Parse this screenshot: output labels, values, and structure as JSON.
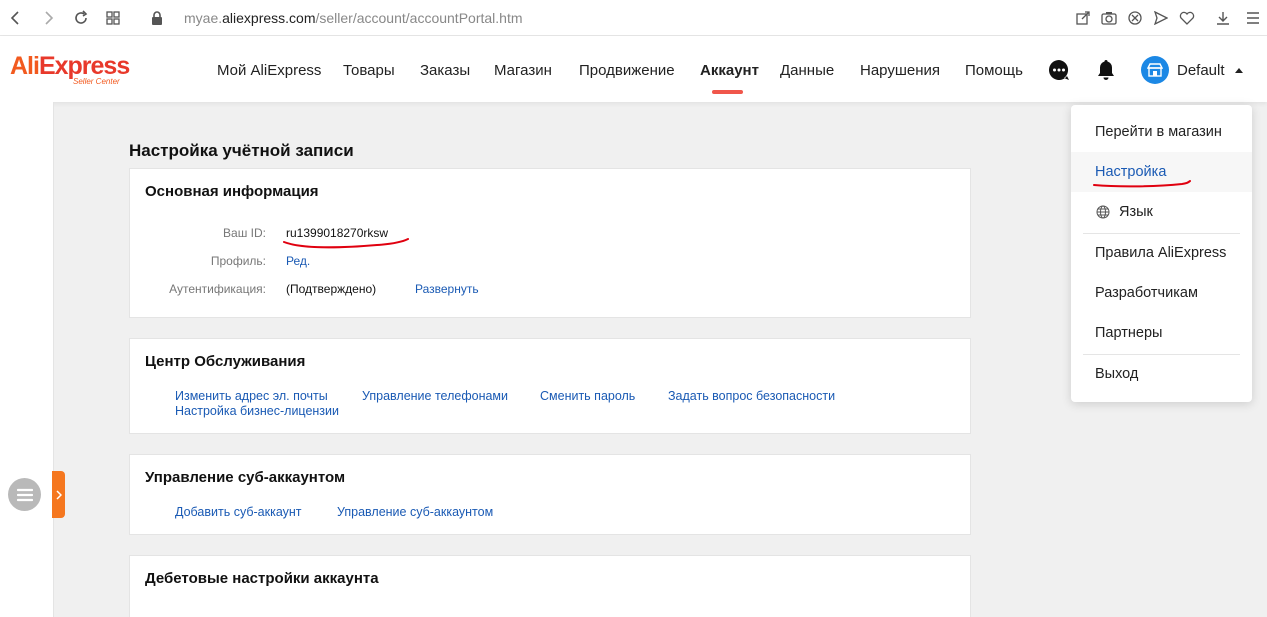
{
  "browser": {
    "url_prefix": "myae.",
    "url_host": "aliexpress.com",
    "url_path": "/seller/account/accountPortal.htm"
  },
  "header": {
    "logo_text_1": "Ali",
    "logo_text_2": "Express",
    "logo_sub": "Seller Center",
    "nav": [
      {
        "label": "Мой AliExpress"
      },
      {
        "label": "Товары"
      },
      {
        "label": "Заказы"
      },
      {
        "label": "Магазин"
      },
      {
        "label": "Продвижение"
      },
      {
        "label": "Аккаунт",
        "active": true
      },
      {
        "label": "Данные"
      },
      {
        "label": "Нарушения"
      },
      {
        "label": "Помощь"
      }
    ],
    "store_name": "Default"
  },
  "page": {
    "title": "Настройка учётной записи"
  },
  "basic_info": {
    "title": "Основная информация",
    "id_label": "Ваш ID:",
    "id_value": "ru1399018270rksw",
    "profile_label": "Профиль:",
    "profile_link": "Ред.",
    "auth_label": "Аутентификация:",
    "auth_value": "(Подтверждено)",
    "auth_link": "Развернуть"
  },
  "service_center": {
    "title": "Центр Обслуживания",
    "links": [
      "Изменить адрес эл. почты",
      "Управление телефонами",
      "Сменить пароль",
      "Задать вопрос безопасности",
      "Настройка бизнес-лицензии"
    ]
  },
  "sub_account": {
    "title": "Управление суб-аккаунтом",
    "links": [
      "Добавить суб-аккаунт",
      "Управление суб-аккаунтом"
    ]
  },
  "debit": {
    "title": "Дебетовые настройки аккаунта"
  },
  "dropdown": {
    "items": [
      {
        "label": "Перейти в магазин"
      },
      {
        "label": "Настройка"
      },
      {
        "label": "Язык"
      },
      {
        "label": "Правила AliExpress"
      },
      {
        "label": "Разработчикам"
      },
      {
        "label": "Партнеры"
      },
      {
        "label": "Выход"
      }
    ]
  },
  "colors": {
    "brand": "#f25a1f",
    "link": "#1a5ab4",
    "active_underline": "#f0564b",
    "avatar": "#1c88e5",
    "annotation": "#e0000f"
  }
}
